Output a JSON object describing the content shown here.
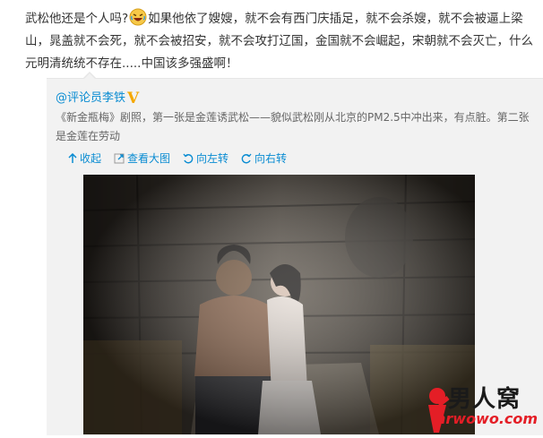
{
  "post": {
    "text_before_emoji": "武松他还是个人吗?",
    "emoji": "laughing-face-icon",
    "text_after_emoji": "如果他依了嫂嫂，就不会有西门庆插足，就不会杀嫂，就不会被逼上梁山，晁盖就不会死，就不会被招安，就不会攻打辽国，金国就不会崛起，宋朝就不会灭亡，什么元明清统统不存在.....中国该多强盛啊！"
  },
  "repost": {
    "author": "@评论员李铁",
    "verified_badge": "V",
    "text": "《新金瓶梅》剧照，第一张是金莲诱武松——貌似武松刚从北京的PM2.5中冲出来，有点脏。第二张是金莲在劳动",
    "actions": {
      "collapse": "收起",
      "view_large": "查看大图",
      "rotate_left": "向左转",
      "rotate_right": "向右转"
    }
  },
  "watermark": {
    "brand": "男人窝",
    "url": "nrwowo.com"
  },
  "colors": {
    "link": "#0a8cd2",
    "repost_bg": "#f2f2f2",
    "badge": "#f5a800",
    "watermark_red": "#e41e26"
  }
}
